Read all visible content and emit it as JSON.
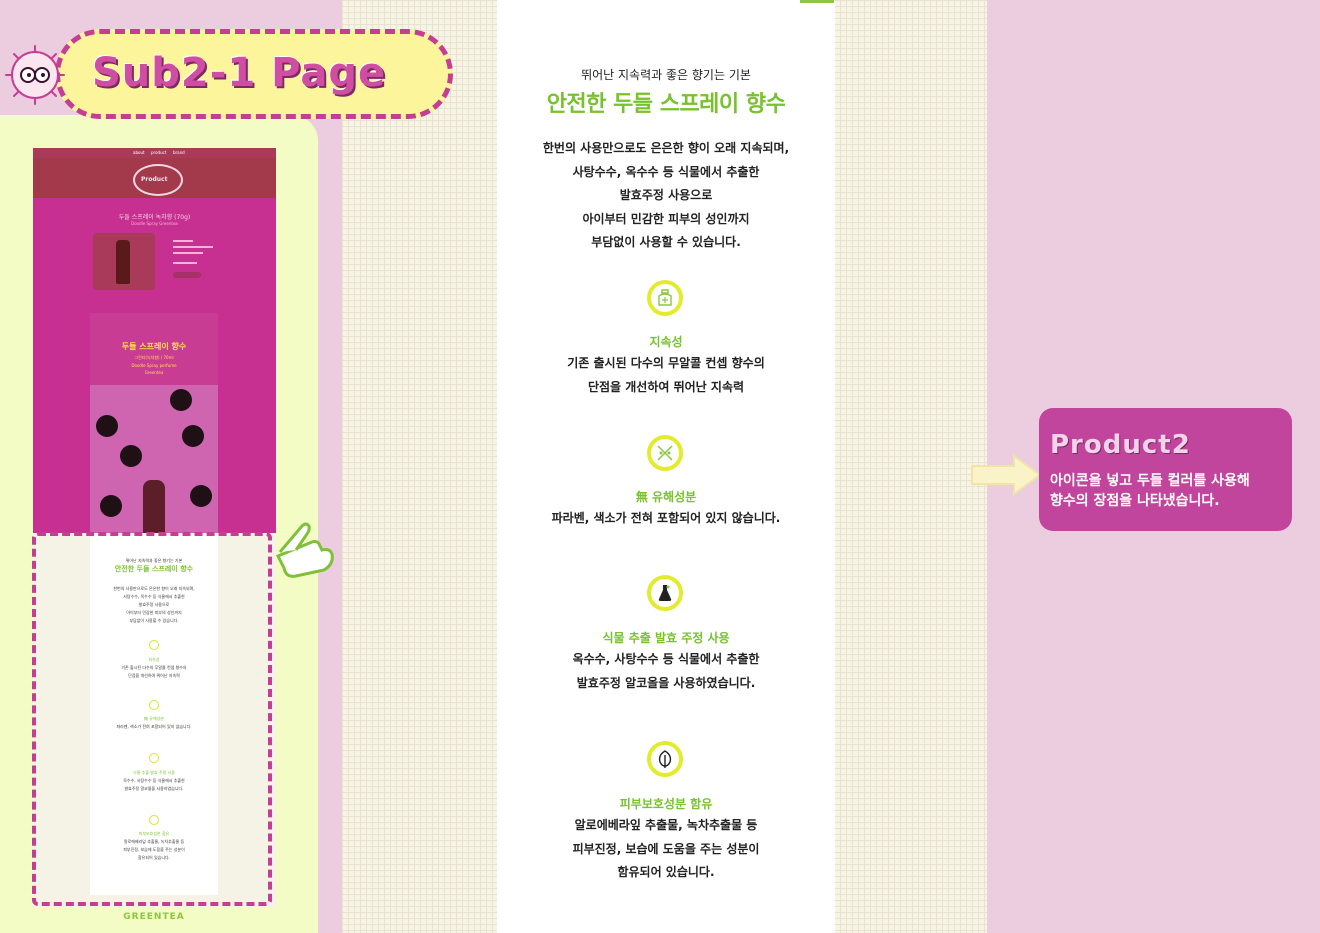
{
  "header": {
    "title": "Sub2-1 Page"
  },
  "mini_preview": {
    "nav": [
      "about",
      "product",
      "brand"
    ],
    "banner_label": "Product",
    "product_title": "두들 스프레이 녹차향 (70g)",
    "product_subtitle": "Doodle Spray Greentea",
    "card_title": "두들 스프레이 향수",
    "card_sub": "그린티(녹차향) / 70ml",
    "card_sub2": "Doodle Spray perfume",
    "card_sub3": "Greentea",
    "footer_label": "GREENTEA"
  },
  "content": {
    "eyebrow": "뛰어난 지속력과 좋은 향기는 기본",
    "headline": "안전한 두들 스프레이 향수",
    "intro": [
      "한번의 사용만으로도 은은한 향이 오래 지속되며,",
      "사탕수수, 옥수수 등 식물에서 추출한",
      "발효주정 사용으로",
      "아이부터 민감한 피부의 성인까지",
      "부담없이 사용할 수 있습니다."
    ],
    "features": [
      {
        "icon": "perfume-bottle-icon",
        "title": "지속성",
        "body": [
          "기존 출시된 다수의 무알콜 컨셉 향수의",
          "단점을 개선하여 뛰어난 지속력"
        ]
      },
      {
        "icon": "no-chemical-icon",
        "title": "無 유해성분",
        "body": [
          "파라벤, 색소가 전혀 포함되어 있지 않습니다."
        ]
      },
      {
        "icon": "flask-icon",
        "title": "식물 추출 발효 주정 사용",
        "body": [
          "옥수수, 사탕수수 등 식물에서 추출한",
          "발효주정 알코올을 사용하였습니다."
        ]
      },
      {
        "icon": "leaf-icon",
        "title": "피부보호성분 함유",
        "body": [
          "알로에베라잎 추출물, 녹차추출물 등",
          "피부진정, 보습에 도움을 주는 성분이",
          "함유되어 있습니다."
        ]
      }
    ]
  },
  "callout": {
    "title": "Product2",
    "body": [
      "아이콘을 넣고 두들 컬러를 사용해",
      "향수의 장점을 나타냈습니다."
    ]
  },
  "colors": {
    "accent_green": "#77c22d",
    "brand_pink": "#c1459c",
    "icon_yellow": "#e3ec2c"
  }
}
